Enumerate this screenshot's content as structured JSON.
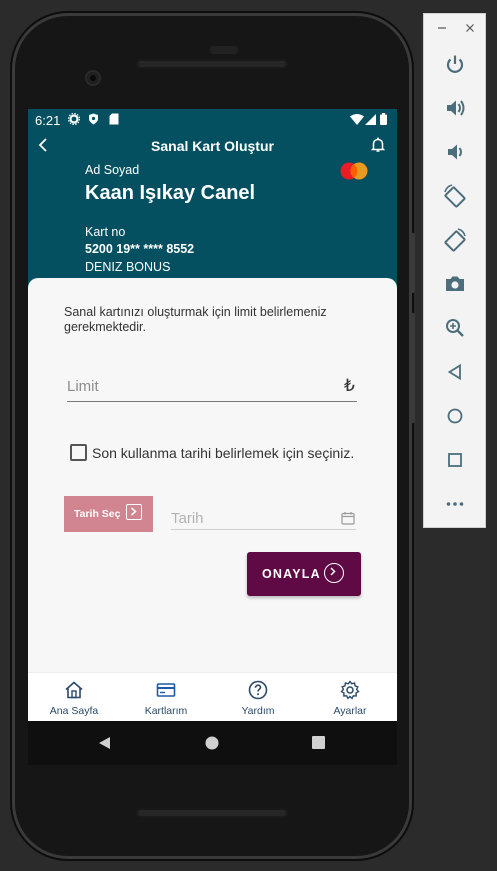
{
  "status_bar": {
    "time": "6:21"
  },
  "app_bar": {
    "title": "Sanal Kart Oluştur",
    "back_icon": "arrow-back-icon",
    "bell_icon": "bell-icon"
  },
  "card": {
    "name_label": "Ad Soyad",
    "name": "Kaan Işıkay Canel",
    "number_label": "Kart no",
    "number": "5200 19** **** 8552",
    "product": "DENIZ BONUS",
    "brand_icon": "mastercard-icon"
  },
  "form": {
    "info": "Sanal kartınızı oluşturmak için limit belirlemeniz gerekmektedir.",
    "limit_placeholder": "Limit",
    "currency_symbol": "₺",
    "expiry_checkbox_label": "Son kullanma tarihi belirlemek için seçiniz.",
    "date_button_label": "Tarih Seç",
    "date_placeholder": "Tarih",
    "confirm_label": "ONAYLA"
  },
  "bottom_nav": [
    {
      "label": "Ana Sayfa",
      "icon": "home-icon"
    },
    {
      "label": "Kartlarım",
      "icon": "card-icon"
    },
    {
      "label": "Yardım",
      "icon": "help-icon"
    },
    {
      "label": "Ayarlar",
      "icon": "settings-icon"
    }
  ],
  "colors": {
    "header_bg": "#045060",
    "confirm_bg": "#5f0a45",
    "date_button_bg": "#d18590",
    "sheet_bg": "#f7f7f7"
  }
}
